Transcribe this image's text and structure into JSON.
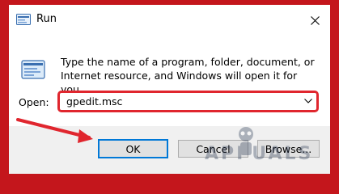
{
  "window": {
    "title": "Run",
    "icons": {
      "app": "run-app-icon",
      "close": "close-icon",
      "run": "run-program-icon"
    }
  },
  "content": {
    "description": "Type the name of a program, folder, document, or Internet resource, and Windows will open it for you.",
    "open_label": "Open:",
    "open_value": "gpedit.msc"
  },
  "buttons": {
    "ok": "OK",
    "cancel": "Cancel",
    "browse": "Browse..."
  },
  "watermark": {
    "text": "APPUALS"
  },
  "colors": {
    "background": "#c4161c",
    "highlight_border": "#e0262e",
    "arrow": "#e0262e",
    "default_button_border": "#0078d7"
  }
}
